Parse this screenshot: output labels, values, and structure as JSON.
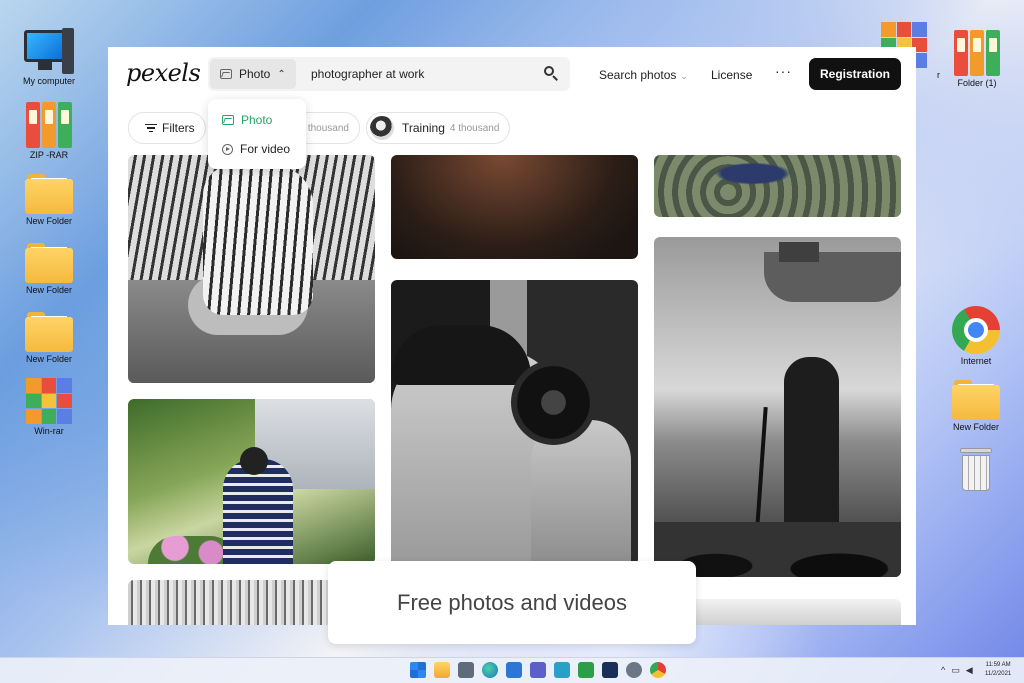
{
  "desktop": {
    "left_icons": [
      {
        "label": "My computer",
        "icon": "computer-icon"
      },
      {
        "label": "ZIP -RAR",
        "icon": "binders-icon"
      },
      {
        "label": "New Folder",
        "icon": "folder-icon"
      },
      {
        "label": "New Folder",
        "icon": "folder-icon"
      },
      {
        "label": "New Folder",
        "icon": "folder-icon"
      },
      {
        "label": "Win-rar",
        "icon": "winrar-icon"
      }
    ],
    "right_icons": [
      {
        "label": "r",
        "icon": "winrar-icon"
      },
      {
        "label": "Folder (1)",
        "icon": "binders-icon"
      },
      {
        "label": "Internet",
        "icon": "chrome-icon"
      },
      {
        "label": "New Folder",
        "icon": "folder-icon"
      },
      {
        "label": "",
        "icon": "trash-icon"
      }
    ]
  },
  "browser": {
    "logo": "pexels",
    "search": {
      "type_label": "Photo",
      "query": "photographer at work"
    },
    "nav": {
      "search_photos": "Search photos",
      "license": "License",
      "more": "···",
      "registration": "Registration"
    },
    "dropdown": {
      "items": [
        {
          "label": "Photo",
          "active": true
        },
        {
          "label": "For video",
          "active": false
        }
      ]
    },
    "filters": {
      "filters_label": "Filters",
      "chip1_count": "thousand",
      "chip2_label": "Training",
      "chip2_count": "4 thousand"
    },
    "caption": "Free photos and videos"
  },
  "taskbar": {
    "time": "11:59 AM",
    "date": "11/2/2021",
    "tray_chevron": "^"
  },
  "colors": {
    "accent_green": "#25a36a",
    "registration_bg": "#111111"
  }
}
